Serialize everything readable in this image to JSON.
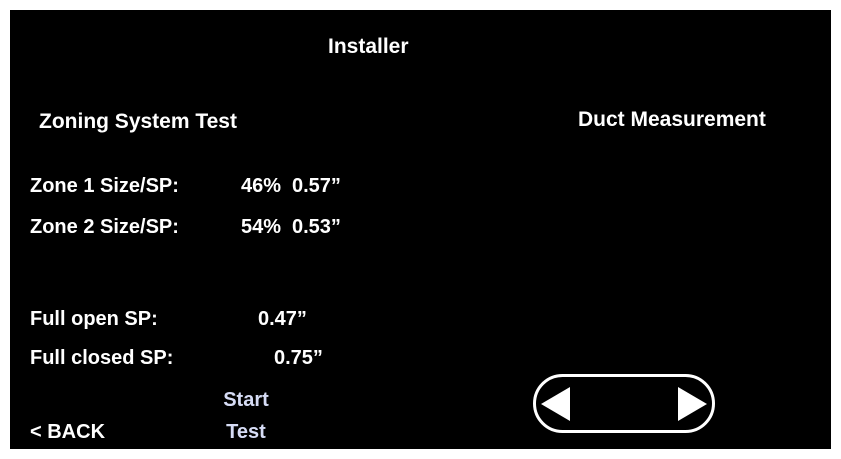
{
  "header": {
    "title": "Installer"
  },
  "sections": {
    "left_heading": "Zoning System Test",
    "right_heading": "Duct Measurement"
  },
  "zones": [
    {
      "label": "Zone 1 Size/SP:",
      "size": "46%",
      "sp": "0.57”"
    },
    {
      "label": "Zone 2 Size/SP:",
      "size": "54%",
      "sp": "0.53”"
    }
  ],
  "pressures": {
    "full_open_label": "Full open SP:",
    "full_open_value": "0.47”",
    "full_closed_label": "Full closed SP:",
    "full_closed_value": "0.75”"
  },
  "buttons": {
    "back_label": "< BACK",
    "start_line1": "Start",
    "start_line2": "Test"
  },
  "icons": {
    "prev": "triangle-left-icon",
    "next": "triangle-right-icon"
  },
  "colors": {
    "background": "#000000",
    "text": "#ffffff",
    "start_text": "#d6dcf5"
  }
}
